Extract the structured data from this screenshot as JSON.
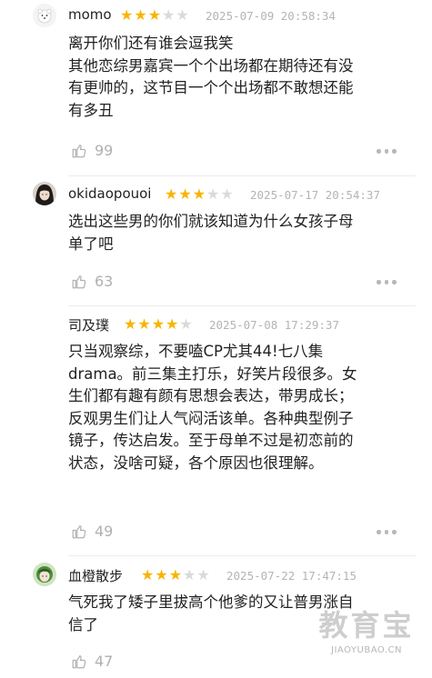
{
  "reviews": [
    {
      "user": "momo",
      "rating": 3,
      "time": "2025-07-09 20:58:34",
      "lines": [
        "离开你们还有谁会逗我笑",
        "其他恋综男嘉宾一个个出场都在期待还有没",
        "有更帅的，这节目一个个出场都不敢想还能",
        "有多丑"
      ],
      "likes": "99",
      "avatar": "white-bear-avatar"
    },
    {
      "user": "okidaopouoi",
      "rating": 3,
      "time": "2025-07-17 20:54:37",
      "lines": [
        "选出这些男的你们就该知道为什么女孩子母",
        "单了吧"
      ],
      "likes": "63",
      "avatar": "dark-hair-girl-avatar"
    },
    {
      "user": "司及璞",
      "rating": 4,
      "time": "2025-07-08 17:29:37",
      "lines": [
        "只当观察综，不要嗑CP尤其44!七八集",
        "drama。前三集主打乐，好笑片段很多。女",
        "生们都有趣有颜有思想会表达，带男成长；",
        "反观男生们让人气闷活该单。各种典型例子",
        "镜子，传达启发。至于母单不过是初恋前的",
        "状态，没啥可疑，各个原因也很理解。"
      ],
      "likes": "49",
      "avatar": ""
    },
    {
      "user": "血橙散步",
      "rating": 3,
      "time": "2025-07-22 17:47:15",
      "lines": [
        "气死我了矮子里拔高个他爹的又让普男涨自",
        "信了"
      ],
      "likes": "47",
      "avatar": "green-character-avatar"
    }
  ],
  "watermark": {
    "main": "教育宝",
    "sub": "JIAOYUBAO.CN"
  },
  "colors": {
    "star_on": "#f7b500",
    "star_off": "#dadada",
    "meta": "#b4b4b4"
  }
}
